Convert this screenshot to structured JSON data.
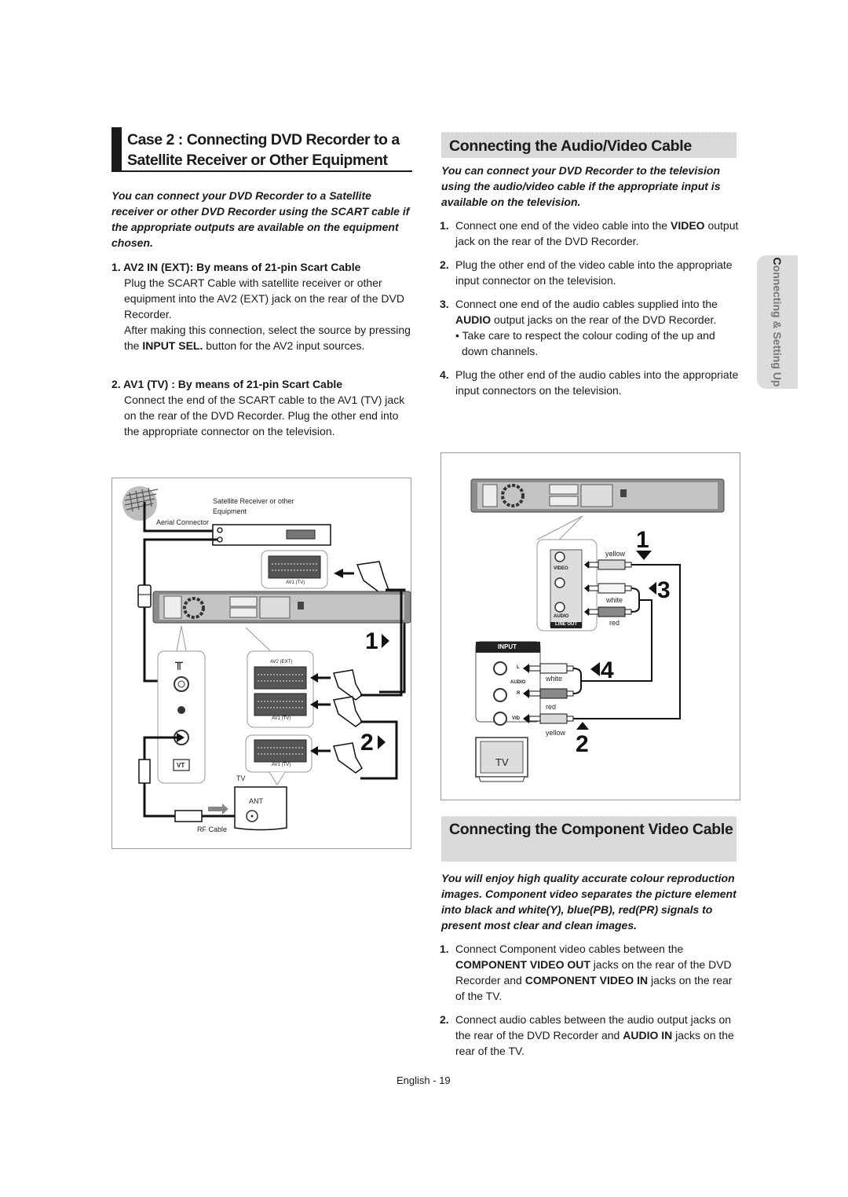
{
  "left": {
    "heading": {
      "line1": "Case 2 : Connecting DVD Recorder to a",
      "line2": "Satellite Receiver or Other Equipment"
    },
    "intro": "You can connect your DVD Recorder to a Satellite receiver or other DVD Recorder using the SCART cable if the appropriate outputs are available on the equipment chosen.",
    "steps": [
      {
        "head": "1. AV2 IN (EXT): By means of 21-pin Scart Cable",
        "body_1": "Plug the SCART Cable with satellite receiver or other equipment into the AV2 (EXT) jack on the rear of the DVD Recorder.",
        "body_2_pre": "After making this connection, select the source by pressing the ",
        "body_2_bold": "INPUT SEL.",
        "body_2_post": " button for the AV2 input sources."
      },
      {
        "head": "2. AV1 (TV) : By means of 21-pin Scart Cable",
        "body_1": "Connect the end of the SCART cable to the AV1 (TV) jack on the rear of the DVD Recorder. Plug the other end into the appropriate connector on the television."
      }
    ],
    "diagram": {
      "satellite_label_1": "Satellite Receiver or other",
      "satellite_label_2": "Equipment",
      "aerial_label": "Aerial Connector",
      "av1_tv_label": "AV1 (TV)",
      "av2_ext_label": "AV2 (EXT)",
      "av1_tv_label_2": "AV1 (TV)",
      "av1_tv_label_3": "AV1 (TV)",
      "tv_label": "TV",
      "ant_label": "ANT",
      "rf_cable_label": "RF Cable",
      "vt_label": "VT",
      "step1": "1",
      "step2": "2"
    }
  },
  "right": {
    "av_section": {
      "heading": "Connecting the Audio/Video Cable",
      "intro": "You can connect your DVD Recorder to the television using the audio/video cable if the appropriate input is available on the television.",
      "steps": [
        {
          "num": "1.",
          "pre": "Connect one end of the video cable into the ",
          "bold": "VIDEO",
          "post": " output jack on the rear of the DVD Recorder."
        },
        {
          "num": "2.",
          "pre": "Plug the other end of the video cable into the appropriate input connector on the television."
        },
        {
          "num": "3.",
          "pre": "Connect one end of the audio cables supplied into the ",
          "bold": "AUDIO",
          "post": " output jacks on the rear of the DVD Recorder.",
          "sub": "• Take care to respect the colour coding of the up and down channels."
        },
        {
          "num": "4.",
          "pre": "Plug the other end of the audio cables into the appropriate input connectors on the television."
        }
      ],
      "diagram": {
        "video_label": "VIDEO",
        "audio_label": "AUDIO",
        "line_out_label": "LINE OUT",
        "input_label": "INPUT",
        "yellow": "yellow",
        "white": "white",
        "red": "red",
        "yellow_2": "yellow",
        "white_2": "white",
        "red_2": "red",
        "l_label": "L",
        "r_label": "R",
        "audio_in_label": "AUDIO",
        "vid_label": "VID",
        "tv_label": "TV",
        "step1": "1",
        "step2": "2",
        "step3": "3",
        "step4": "4",
        "cable_colors": {
          "yellow": "#d8d8d8",
          "white": "#f4f4f4",
          "red": "#8a8a8a"
        }
      }
    },
    "component_section": {
      "heading": "Connecting the Component Video Cable",
      "intro": "You will enjoy high quality accurate colour reproduction images. Component video separates the picture element into black and white(Y), blue(PB), red(PR) signals to present most clear and clean images.",
      "steps": [
        {
          "num": "1.",
          "pre": "Connect Component video cables between the ",
          "bold": "COMPONENT VIDEO OUT",
          "mid": " jacks on the rear of the DVD Recorder and ",
          "bold2": "COMPONENT VIDEO IN",
          "post": " jacks on the rear of the TV."
        },
        {
          "num": "2.",
          "pre": "Connect audio cables between the audio output jacks on the rear of the DVD Recorder and ",
          "bold": "AUDIO IN",
          "post": " jacks on the rear of the TV."
        }
      ]
    }
  },
  "side_tab": "Connecting & Setting Up",
  "footer": {
    "page": "English - 19"
  },
  "colors": {
    "heading_bg": "#d9d9d9",
    "side_tab_bg": "#dcdcdc",
    "text": "#1a1a1a"
  }
}
